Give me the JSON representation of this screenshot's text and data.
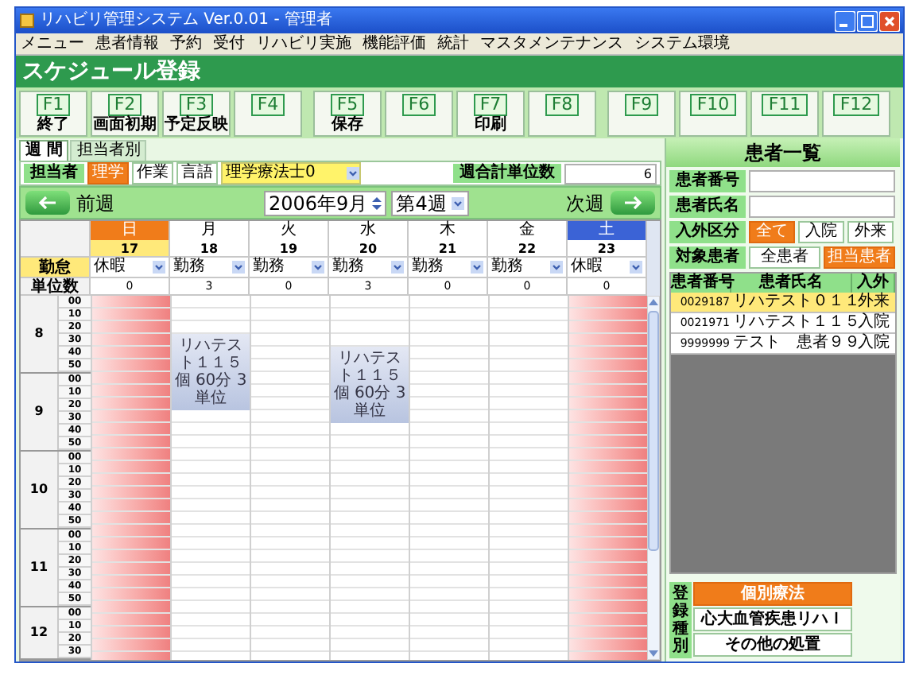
{
  "window": {
    "title": "リハビリ管理システム Ver.0.01 - 管理者"
  },
  "menu": [
    "メニュー",
    "患者情報",
    "予約",
    "受付",
    "リハビリ実施",
    "機能評価",
    "統計",
    "マスタメンテナンス",
    "システム環境"
  ],
  "header": "スケジュール登録",
  "function_keys": [
    {
      "key": "F1",
      "label": "終了"
    },
    {
      "key": "F2",
      "label": "画面初期"
    },
    {
      "key": "F3",
      "label": "予定反映"
    },
    {
      "key": "F4"
    },
    {
      "key": "F5",
      "label": "保存"
    },
    {
      "key": "F6"
    },
    {
      "key": "F7",
      "label": "印刷"
    },
    {
      "key": "F8"
    },
    {
      "key": "F9"
    },
    {
      "key": "F10"
    },
    {
      "key": "F11"
    },
    {
      "key": "F12"
    }
  ],
  "tabs": [
    {
      "label": "週 間",
      "selected": true
    },
    {
      "label": "担当者別",
      "selected": false
    }
  ],
  "filter": {
    "label": "担当者",
    "options": [
      {
        "label": "理学",
        "selected": true
      },
      {
        "label": "作業",
        "selected": false
      },
      {
        "label": "言語",
        "selected": false
      }
    ],
    "staff": "理学療法士0",
    "total_label": "週合計単位数",
    "total": "6"
  },
  "nav": {
    "prev": "前週",
    "month": "2006年9月",
    "week": "第4週",
    "next": "次週"
  },
  "schedule": {
    "attendance_label": "勤怠",
    "units_label": "単位数",
    "days": [
      {
        "weekday": "日",
        "date": "17",
        "kind": "sunday",
        "attendance": "休暇",
        "units": "0",
        "slots": [
          {
            "booked": false
          },
          {
            "booked": false
          },
          {
            "booked": false
          },
          {
            "booked": false
          },
          {
            "booked": false
          },
          {
            "booked": false
          },
          {
            "booked": false
          },
          {
            "booked": false
          },
          {
            "booked": false
          },
          {
            "booked": false
          },
          {
            "booked": false
          },
          {
            "booked": false
          },
          {
            "booked": false
          },
          {
            "booked": false
          },
          {
            "booked": false
          },
          {
            "booked": false
          },
          {
            "booked": false
          },
          {
            "booked": false
          },
          {
            "booked": false
          },
          {
            "booked": false
          },
          {
            "booked": false
          },
          {
            "booked": false
          },
          {
            "booked": false
          },
          {
            "booked": false
          },
          {
            "booked": false
          },
          {
            "booked": false
          },
          {
            "booked": false
          },
          {
            "booked": false
          }
        ]
      },
      {
        "weekday": "月",
        "date": "18",
        "kind": "weekday",
        "attendance": "勤務",
        "units": "3",
        "slots": [
          {
            "booked": false
          },
          {
            "booked": false
          },
          {
            "booked": false
          },
          {
            "booked": true,
            "name": "リハテスト１１５",
            "type": "個",
            "duration": "60分",
            "units": "3単位"
          },
          {
            "booked": true
          },
          {
            "booked": true
          },
          {
            "booked": true
          },
          {
            "booked": true
          },
          {
            "booked": true
          },
          {
            "booked": false
          },
          {
            "booked": false
          },
          {
            "booked": false
          },
          {
            "booked": false
          },
          {
            "booked": false
          },
          {
            "booked": false
          },
          {
            "booked": false
          },
          {
            "booked": false
          },
          {
            "booked": false
          },
          {
            "booked": false
          },
          {
            "booked": false
          },
          {
            "booked": false
          },
          {
            "booked": false
          },
          {
            "booked": false
          },
          {
            "booked": false
          },
          {
            "booked": false
          },
          {
            "booked": false
          },
          {
            "booked": false
          },
          {
            "booked": false
          }
        ]
      },
      {
        "weekday": "火",
        "date": "19",
        "kind": "weekday",
        "attendance": "勤務",
        "units": "0",
        "slots": [
          {
            "booked": false
          },
          {
            "booked": false
          },
          {
            "booked": false
          },
          {
            "booked": false
          },
          {
            "booked": false
          },
          {
            "booked": false
          },
          {
            "booked": false
          },
          {
            "booked": false
          },
          {
            "booked": false
          },
          {
            "booked": false
          },
          {
            "booked": false
          },
          {
            "booked": false
          },
          {
            "booked": false
          },
          {
            "booked": false
          },
          {
            "booked": false
          },
          {
            "booked": false
          },
          {
            "booked": false
          },
          {
            "booked": false
          },
          {
            "booked": false
          },
          {
            "booked": false
          },
          {
            "booked": false
          },
          {
            "booked": false
          },
          {
            "booked": false
          },
          {
            "booked": false
          },
          {
            "booked": false
          },
          {
            "booked": false
          },
          {
            "booked": false
          },
          {
            "booked": false
          }
        ]
      },
      {
        "weekday": "水",
        "date": "20",
        "kind": "weekday",
        "attendance": "勤務",
        "units": "3",
        "slots": [
          {
            "booked": false
          },
          {
            "booked": false
          },
          {
            "booked": false
          },
          {
            "booked": false
          },
          {
            "booked": true,
            "name": "リハテスト１１５",
            "type": "個",
            "duration": "60分",
            "units": "3単位"
          },
          {
            "booked": true
          },
          {
            "booked": true
          },
          {
            "booked": true
          },
          {
            "booked": true
          },
          {
            "booked": true
          },
          {
            "booked": false
          },
          {
            "booked": false
          },
          {
            "booked": false
          },
          {
            "booked": false
          },
          {
            "booked": false
          },
          {
            "booked": false
          },
          {
            "booked": false
          },
          {
            "booked": false
          },
          {
            "booked": false
          },
          {
            "booked": false
          },
          {
            "booked": false
          },
          {
            "booked": false
          },
          {
            "booked": false
          },
          {
            "booked": false
          },
          {
            "booked": false
          },
          {
            "booked": false
          },
          {
            "booked": false
          },
          {
            "booked": false
          }
        ]
      },
      {
        "weekday": "木",
        "date": "21",
        "kind": "weekday",
        "attendance": "勤務",
        "units": "0",
        "slots": [
          {
            "booked": false
          },
          {
            "booked": false
          },
          {
            "booked": false
          },
          {
            "booked": false
          },
          {
            "booked": false
          },
          {
            "booked": false
          },
          {
            "booked": false
          },
          {
            "booked": false
          },
          {
            "booked": false
          },
          {
            "booked": false
          },
          {
            "booked": false
          },
          {
            "booked": false
          },
          {
            "booked": false
          },
          {
            "booked": false
          },
          {
            "booked": false
          },
          {
            "booked": false
          },
          {
            "booked": false
          },
          {
            "booked": false
          },
          {
            "booked": false
          },
          {
            "booked": false
          },
          {
            "booked": false
          },
          {
            "booked": false
          },
          {
            "booked": false
          },
          {
            "booked": false
          },
          {
            "booked": false
          },
          {
            "booked": false
          },
          {
            "booked": false
          },
          {
            "booked": false
          }
        ]
      },
      {
        "weekday": "金",
        "date": "22",
        "kind": "weekday",
        "attendance": "勤務",
        "units": "0",
        "slots": [
          {
            "booked": false
          },
          {
            "booked": false
          },
          {
            "booked": false
          },
          {
            "booked": false
          },
          {
            "booked": false
          },
          {
            "booked": false
          },
          {
            "booked": false
          },
          {
            "booked": false
          },
          {
            "booked": false
          },
          {
            "booked": false
          },
          {
            "booked": false
          },
          {
            "booked": false
          },
          {
            "booked": false
          },
          {
            "booked": false
          },
          {
            "booked": false
          },
          {
            "booked": false
          },
          {
            "booked": false
          },
          {
            "booked": false
          },
          {
            "booked": false
          },
          {
            "booked": false
          },
          {
            "booked": false
          },
          {
            "booked": false
          },
          {
            "booked": false
          },
          {
            "booked": false
          },
          {
            "booked": false
          },
          {
            "booked": false
          },
          {
            "booked": false
          },
          {
            "booked": false
          }
        ]
      },
      {
        "weekday": "土",
        "date": "23",
        "kind": "saturday",
        "attendance": "休暇",
        "units": "0",
        "slots": [
          {
            "booked": false
          },
          {
            "booked": false
          },
          {
            "booked": false
          },
          {
            "booked": false
          },
          {
            "booked": false
          },
          {
            "booked": false
          },
          {
            "booked": false
          },
          {
            "booked": false
          },
          {
            "booked": false
          },
          {
            "booked": false
          },
          {
            "booked": false
          },
          {
            "booked": false
          },
          {
            "booked": false
          },
          {
            "booked": false
          },
          {
            "booked": false
          },
          {
            "booked": false
          },
          {
            "booked": false
          },
          {
            "booked": false
          },
          {
            "booked": false
          },
          {
            "booked": false
          },
          {
            "booked": false
          },
          {
            "booked": false
          },
          {
            "booked": false
          },
          {
            "booked": false
          },
          {
            "booked": false
          },
          {
            "booked": false
          },
          {
            "booked": false
          },
          {
            "booked": false
          }
        ]
      }
    ],
    "hours": [
      {
        "hour": "8",
        "minutes": [
          "00",
          "10",
          "20",
          "30",
          "40",
          "50"
        ]
      },
      {
        "hour": "9",
        "minutes": [
          "00",
          "10",
          "20",
          "30",
          "40",
          "50"
        ]
      },
      {
        "hour": "10",
        "minutes": [
          "00",
          "10",
          "20",
          "30",
          "40",
          "50"
        ]
      },
      {
        "hour": "11",
        "minutes": [
          "00",
          "10",
          "20",
          "30",
          "40",
          "50"
        ]
      },
      {
        "hour": "12",
        "minutes": [
          "00",
          "10",
          "20",
          "30"
        ]
      }
    ]
  },
  "patients": {
    "title": "患者一覧",
    "number_label": "患者番号",
    "name_label": "患者氏名",
    "inout_label": "入外区分",
    "inout_options": [
      {
        "label": "全て",
        "selected": true
      },
      {
        "label": "入院",
        "selected": false
      },
      {
        "label": "外来",
        "selected": false
      }
    ],
    "target_label": "対象患者",
    "target_options": [
      {
        "label": "全患者",
        "selected": false
      },
      {
        "label": "担当患者",
        "selected": true
      }
    ],
    "columns": [
      "患者番号",
      "患者氏名",
      "入外"
    ],
    "rows": [
      {
        "number": "0029187",
        "name": "リハテスト０１１",
        "type": "外来",
        "selected": true
      },
      {
        "number": "0021971",
        "name": "リハテスト１１５",
        "type": "入院",
        "selected": false
      },
      {
        "number": "9999999",
        "name": "テスト　患者９９",
        "type": "入院",
        "selected": false
      }
    ]
  },
  "registration": {
    "label": "登録種別",
    "options": [
      {
        "label": "個別療法",
        "selected": true
      },
      {
        "label": "心大血管疾患リハＩ",
        "selected": false
      },
      {
        "label": "その他の処置",
        "selected": false
      }
    ]
  }
}
